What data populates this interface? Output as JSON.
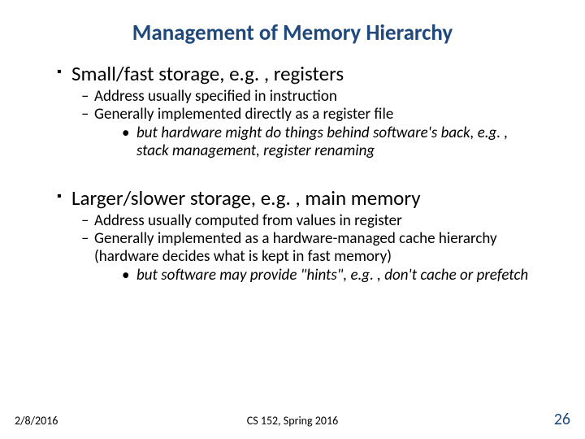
{
  "title": "Management of Memory Hierarchy",
  "sections": [
    {
      "heading": "Small/fast storage, e.g. , registers",
      "points": [
        "Address usually specified in instruction",
        "Generally implemented directly as a register file"
      ],
      "subnote": "but hardware might do things behind software's back, e.g. , stack management, register renaming"
    },
    {
      "heading": "Larger/slower storage, e.g. , main memory",
      "points": [
        "Address usually computed from values in register",
        "Generally implemented as a hardware-managed cache hierarchy (hardware decides what is kept in fast memory)"
      ],
      "subnote": "but software may provide \"hints\", e.g. , don't cache or prefetch"
    }
  ],
  "footer": {
    "date": "2/8/2016",
    "course": "CS 152, Spring 2016",
    "page": "26"
  }
}
